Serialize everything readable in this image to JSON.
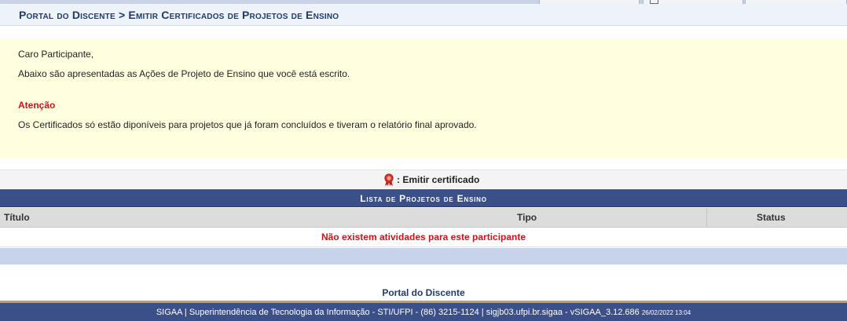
{
  "header": {
    "breadcrumb_title": "Portal do Discente > Emitir Certificados de Projetos de Ensino"
  },
  "info": {
    "greeting": "Caro Participante,",
    "intro": "Abaixo são apresentadas as Ações de Projeto de Ensino que você está escrito.",
    "warning_title": "Atenção",
    "warning_text": "Os Certificados só estão diponíveis para projetos que já foram concluídos e tiveram o relatório final aprovado."
  },
  "legend": {
    "icon": "ribbon-award-icon",
    "label": ": Emitir certificado",
    "icon_color": "#d9322a"
  },
  "list": {
    "title": "Lista de Projetos de Ensino",
    "columns": [
      "Título",
      "Tipo",
      "Status"
    ],
    "empty_message": "Não existem atividades para este participante"
  },
  "navigation": {
    "portal_link": "Portal do Discente"
  },
  "footer": {
    "text": "SIGAA | Superintendência de Tecnologia da Informação - STI/UFPI - (86) 3215-1124 | sigjb03.ufpi.br.sigaa - vSIGAA_3.12.686",
    "timestamp": "26/02/2022 13:04"
  },
  "colors": {
    "header_blue": "#3b5089",
    "title_blue": "#1f3a6e",
    "alert_red": "#c4161c",
    "info_background": "#ffffe0",
    "footer_accent": "#c59e5b"
  }
}
